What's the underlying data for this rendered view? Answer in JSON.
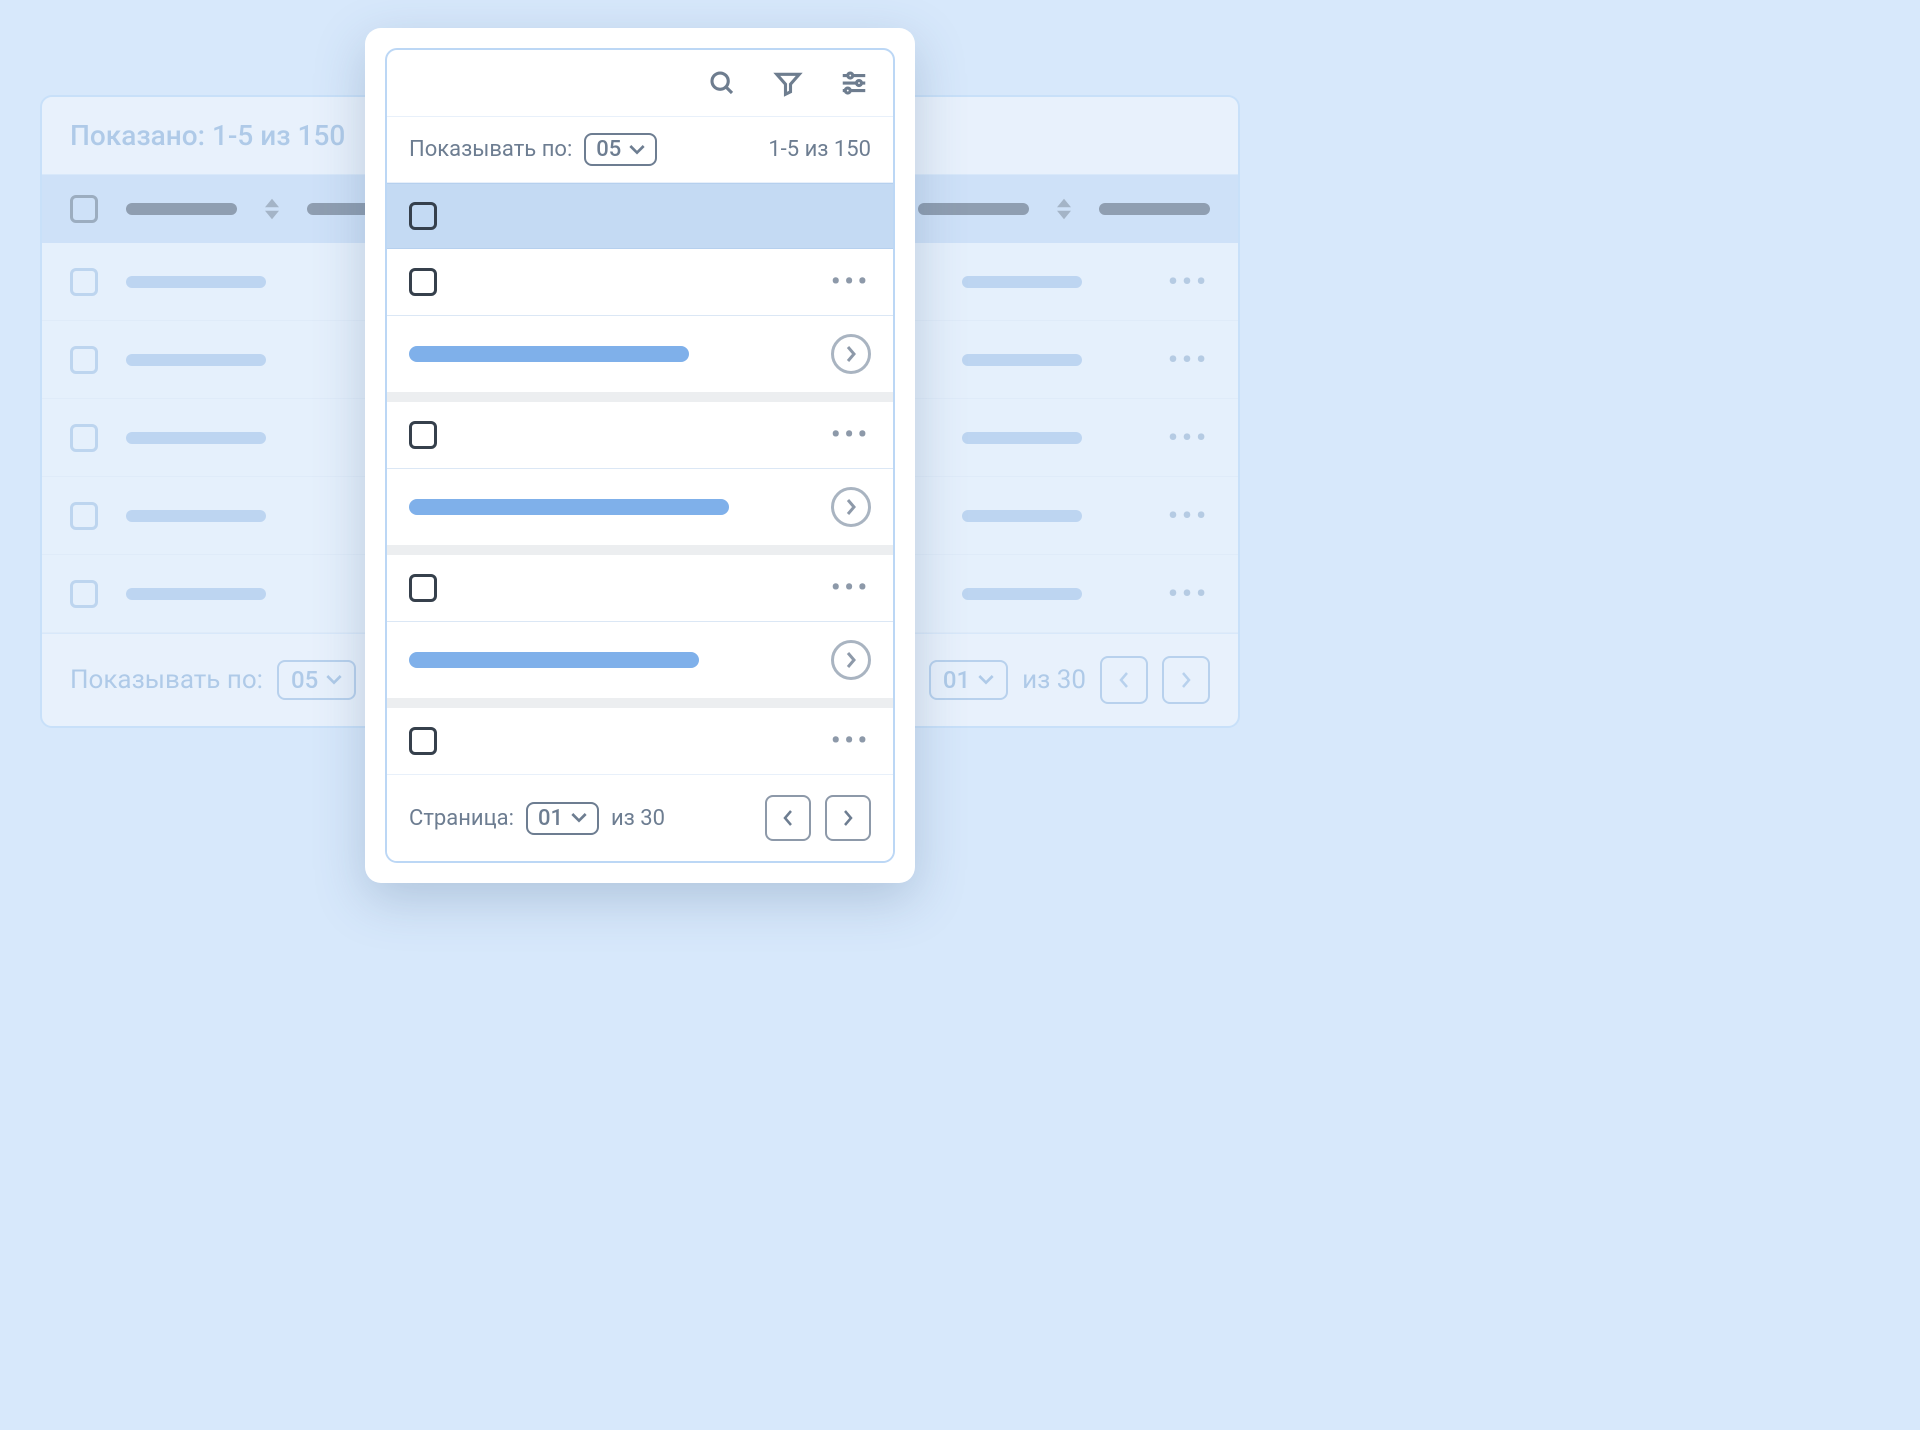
{
  "desktop": {
    "shown_label": "Показано: 1-5 из 150",
    "per_page_label": "Показывать по:",
    "per_page_value": "05",
    "page_value": "01",
    "of_pages": "из 30"
  },
  "mobile": {
    "per_page_label": "Показывать по:",
    "per_page_value": "05",
    "range_text": "1-5 из 150",
    "page_label": "Страница:",
    "page_value": "01",
    "of_pages": "из 30"
  }
}
